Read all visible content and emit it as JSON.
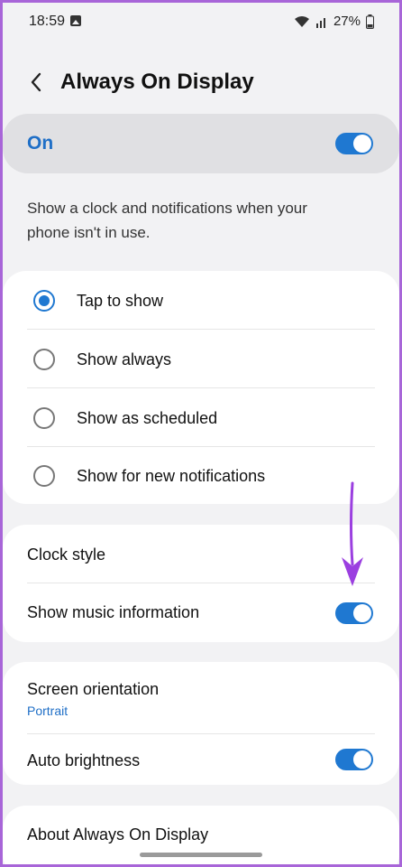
{
  "status_bar": {
    "time": "18:59",
    "battery": "27%"
  },
  "header": {
    "title": "Always On Display"
  },
  "master_toggle": {
    "label": "On",
    "state": "on"
  },
  "description": "Show a clock and notifications when your phone isn't in use.",
  "display_modes": [
    {
      "label": "Tap to show",
      "selected": true
    },
    {
      "label": "Show always",
      "selected": false
    },
    {
      "label": "Show as scheduled",
      "selected": false
    },
    {
      "label": "Show for new notifications",
      "selected": false
    }
  ],
  "clock_section": {
    "clock_style_label": "Clock style",
    "music_info_label": "Show music information",
    "music_info_state": "on"
  },
  "display_section": {
    "orientation_label": "Screen orientation",
    "orientation_value": "Portrait",
    "auto_brightness_label": "Auto brightness",
    "auto_brightness_state": "on"
  },
  "about": {
    "label": "About Always On Display"
  },
  "colors": {
    "accent": "#1f78d1",
    "frame": "#a865d8",
    "arrow": "#9b3fe0"
  },
  "icons": {
    "back": "chevron-left-icon",
    "gallery": "image-icon",
    "wifi": "wifi-icon",
    "signal": "signal-icon",
    "battery": "battery-icon",
    "annotation": "arrow-down-icon"
  }
}
